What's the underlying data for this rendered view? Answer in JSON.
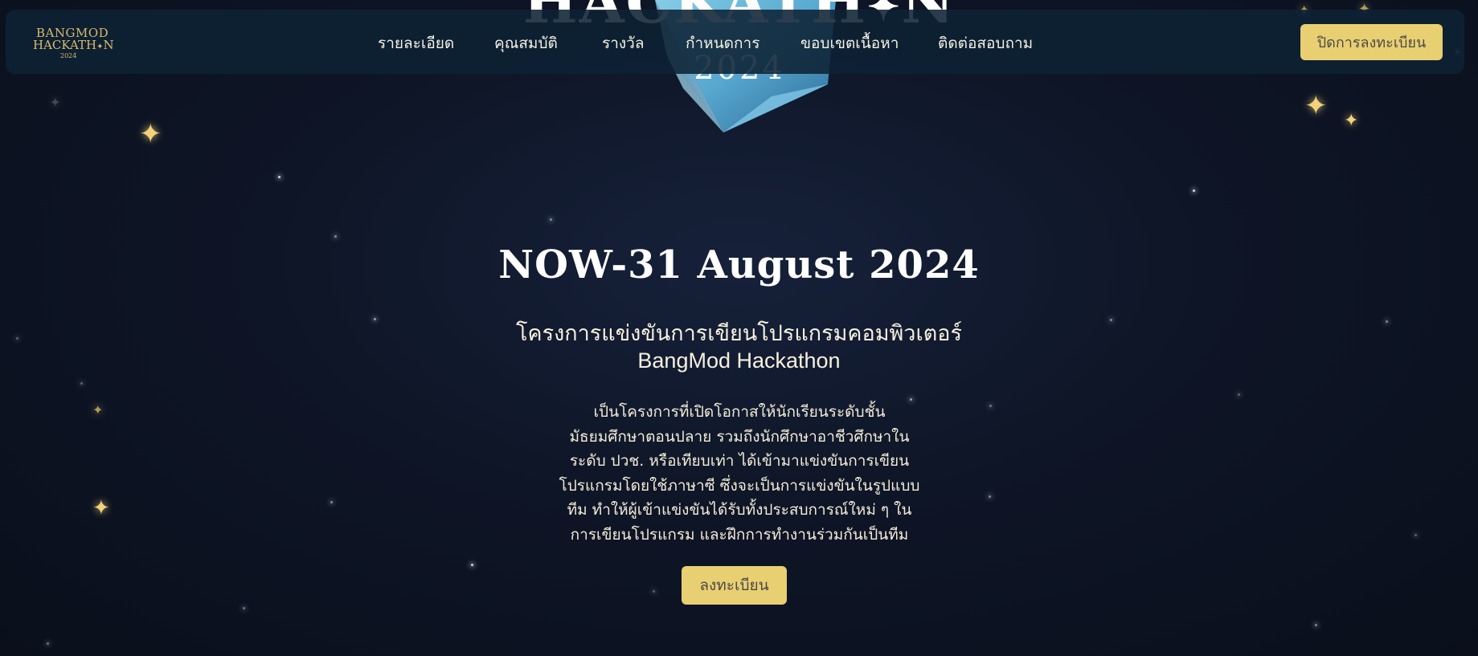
{
  "brand": {
    "logo_line1": "BANGMOD",
    "logo_line2": "HACKATH",
    "logo_line2_end": "N",
    "logo_year": "2024",
    "accent_color": "#e8cf72",
    "background_color": "#0e1526"
  },
  "navbar": {
    "links": [
      {
        "label": "รายละเอียด"
      },
      {
        "label": "คุณสมบัติ"
      },
      {
        "label": "รางวัล"
      },
      {
        "label": "กำหนดการ"
      },
      {
        "label": "ขอบเขตเนื้อหา"
      },
      {
        "label": "ติดต่อสอบถาม"
      }
    ],
    "cta_label": "ปิดการลงทะเบียน"
  },
  "hero": {
    "banner_text": "HACKATH",
    "banner_text_end": "N",
    "banner_year": "2024",
    "headline": "NOW-31 August 2024",
    "subtitle_th": "โครงการแข่งขันการเขียนโปรแกรมคอมพิวเตอร์",
    "subtitle_en": "BangMod Hackathon",
    "description_lines": [
      "เป็นโครงการที่เปิดโอกาสให้นักเรียนระดับชั้น",
      "มัธยมศึกษาตอนปลาย รวมถึงนักศึกษาอาชีวศึกษาใน",
      "ระดับ ปวช. หรือเทียบเท่า ได้เข้ามาแข่งขันการเขียน",
      "โปรแกรมโดยใช้ภาษาซี ซึ่งจะเป็นการแข่งขันในรูปแบบ",
      "ทีม ทำให้ผู้เข้าแข่งขันได้รับทั้งประสบการณ์ใหม่ ๆ ใน",
      "การเขียนโปรแกรม และฝึกการทำงานร่วมกันเป็นทีม"
    ],
    "register_label": "ลงทะเบียน"
  }
}
